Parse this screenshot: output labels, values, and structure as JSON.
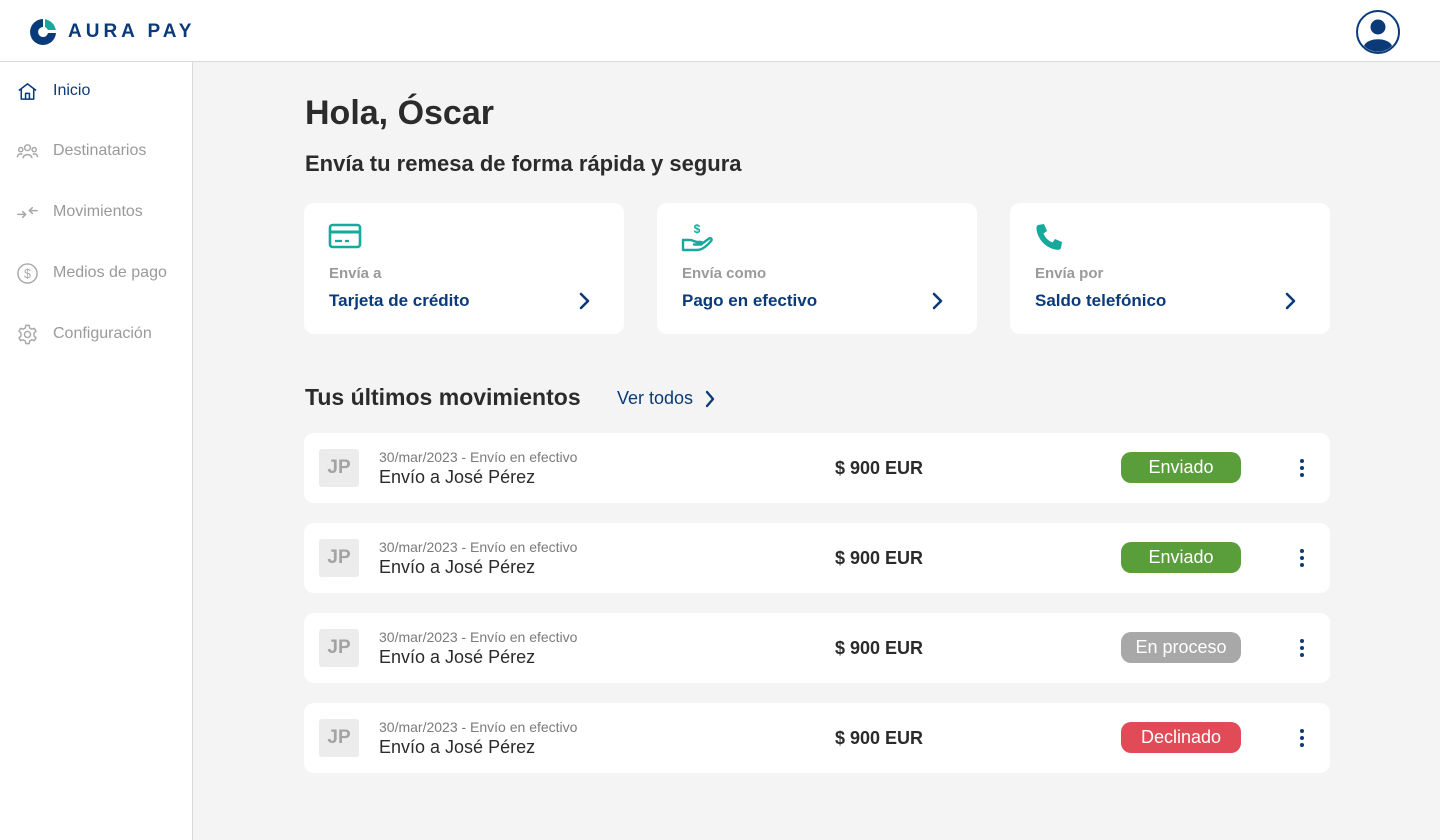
{
  "brand": {
    "name": "AURA PAY",
    "color": "#0b3a78",
    "accent": "#17a99c"
  },
  "header": {
    "avatar_icon": "user-avatar-icon"
  },
  "sidebar": {
    "items": [
      {
        "label": "Inicio",
        "icon": "home-icon",
        "active": true
      },
      {
        "label": "Destinatarios",
        "icon": "users-icon",
        "active": false
      },
      {
        "label": "Movimientos",
        "icon": "transfer-arrows-icon",
        "active": false
      },
      {
        "label": "Medios de pago",
        "icon": "dollar-circle-icon",
        "active": false
      },
      {
        "label": "Configuración",
        "icon": "gear-icon",
        "active": false
      }
    ]
  },
  "main": {
    "greeting": "Hola, Óscar",
    "subtitle": "Envía tu remesa de forma rápida y segura",
    "cards": [
      {
        "caption": "Envía a",
        "title": "Tarjeta de crédito",
        "icon": "credit-card-icon"
      },
      {
        "caption": "Envía como",
        "title": "Pago en efectivo",
        "icon": "cash-hand-icon"
      },
      {
        "caption": "Envía por",
        "title": "Saldo telefónico",
        "icon": "phone-icon"
      }
    ],
    "movements": {
      "title": "Tus últimos movimientos",
      "see_all": "Ver todos",
      "rows": [
        {
          "initials": "JP",
          "meta": "30/mar/2023 - Envío en efectivo",
          "name": "Envío a José Pérez",
          "amount": "$ 900 EUR",
          "status": "Enviado",
          "status_color": "#5a9e3c"
        },
        {
          "initials": "JP",
          "meta": "30/mar/2023 - Envío en efectivo",
          "name": "Envío a José Pérez",
          "amount": "$ 900 EUR",
          "status": "Enviado",
          "status_color": "#5a9e3c"
        },
        {
          "initials": "JP",
          "meta": "30/mar/2023 - Envío en efectivo",
          "name": "Envío a José Pérez",
          "amount": "$ 900 EUR",
          "status": "En proceso",
          "status_color": "#a8a8a8"
        },
        {
          "initials": "JP",
          "meta": "30/mar/2023 - Envío en efectivo",
          "name": "Envío a José Pérez",
          "amount": "$ 900 EUR",
          "status": "Declinado",
          "status_color": "#e04b57"
        }
      ]
    }
  }
}
